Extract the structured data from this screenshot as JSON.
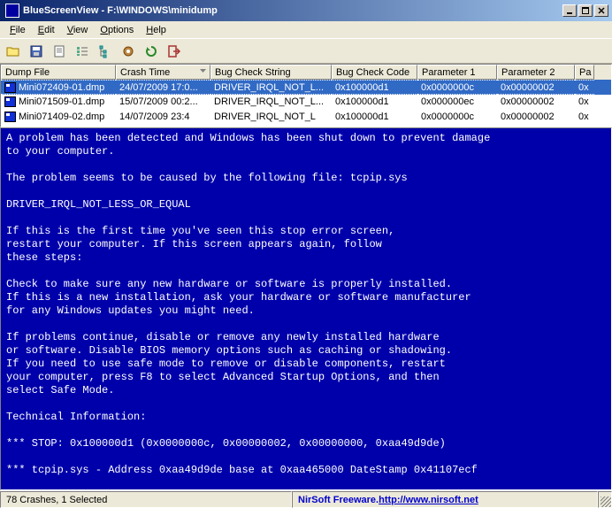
{
  "window": {
    "title": "BlueScreenView  -  F:\\WINDOWS\\minidump"
  },
  "menu": {
    "file": "File",
    "edit": "Edit",
    "view": "View",
    "options": "Options",
    "help": "Help"
  },
  "toolbar": {
    "icons": [
      "open-icon",
      "save-icon",
      "delete-icon",
      "properties-icon",
      "options-icon",
      "find-icon",
      "refresh-icon"
    ]
  },
  "columns": {
    "c0": "Dump File",
    "c1": "Crash Time",
    "c2": "Bug Check String",
    "c3": "Bug Check Code",
    "c4": "Parameter 1",
    "c5": "Parameter 2",
    "c6": "Pa"
  },
  "rows": [
    {
      "file": "Mini072409-01.dmp",
      "time": "24/07/2009 17:0...",
      "str": "DRIVER_IRQL_NOT_L...",
      "code": "0x100000d1",
      "p1": "0x0000000c",
      "p2": "0x00000002",
      "p3": "0x"
    },
    {
      "file": "Mini071509-01.dmp",
      "time": "15/07/2009 00:2...",
      "str": "DRIVER_IRQL_NOT_L...",
      "code": "0x100000d1",
      "p1": "0x000000ec",
      "p2": "0x00000002",
      "p3": "0x"
    },
    {
      "file": "Mini071409-02.dmp",
      "time": "14/07/2009 23:4",
      "str": "DRIVER_IRQL_NOT_L",
      "code": "0x100000d1",
      "p1": "0x0000000c",
      "p2": "0x00000002",
      "p3": "0x"
    }
  ],
  "bsod": "A problem has been detected and Windows has been shut down to prevent damage\nto your computer.\n\nThe problem seems to be caused by the following file: tcpip.sys\n\nDRIVER_IRQL_NOT_LESS_OR_EQUAL\n\nIf this is the first time you've seen this stop error screen,\nrestart your computer. If this screen appears again, follow\nthese steps:\n\nCheck to make sure any new hardware or software is properly installed.\nIf this is a new installation, ask your hardware or software manufacturer\nfor any Windows updates you might need.\n\nIf problems continue, disable or remove any newly installed hardware\nor software. Disable BIOS memory options such as caching or shadowing.\nIf you need to use safe mode to remove or disable components, restart\nyour computer, press F8 to select Advanced Startup Options, and then\nselect Safe Mode.\n\nTechnical Information:\n\n*** STOP: 0x100000d1 (0x0000000c, 0x00000002, 0x00000000, 0xaa49d9de)\n\n*** tcpip.sys - Address 0xaa49d9de base at 0xaa465000 DateStamp 0x41107ecf",
  "status": {
    "left": "78 Crashes, 1 Selected",
    "brand": "NirSoft Freeware. ",
    "url": "http://www.nirsoft.net"
  }
}
